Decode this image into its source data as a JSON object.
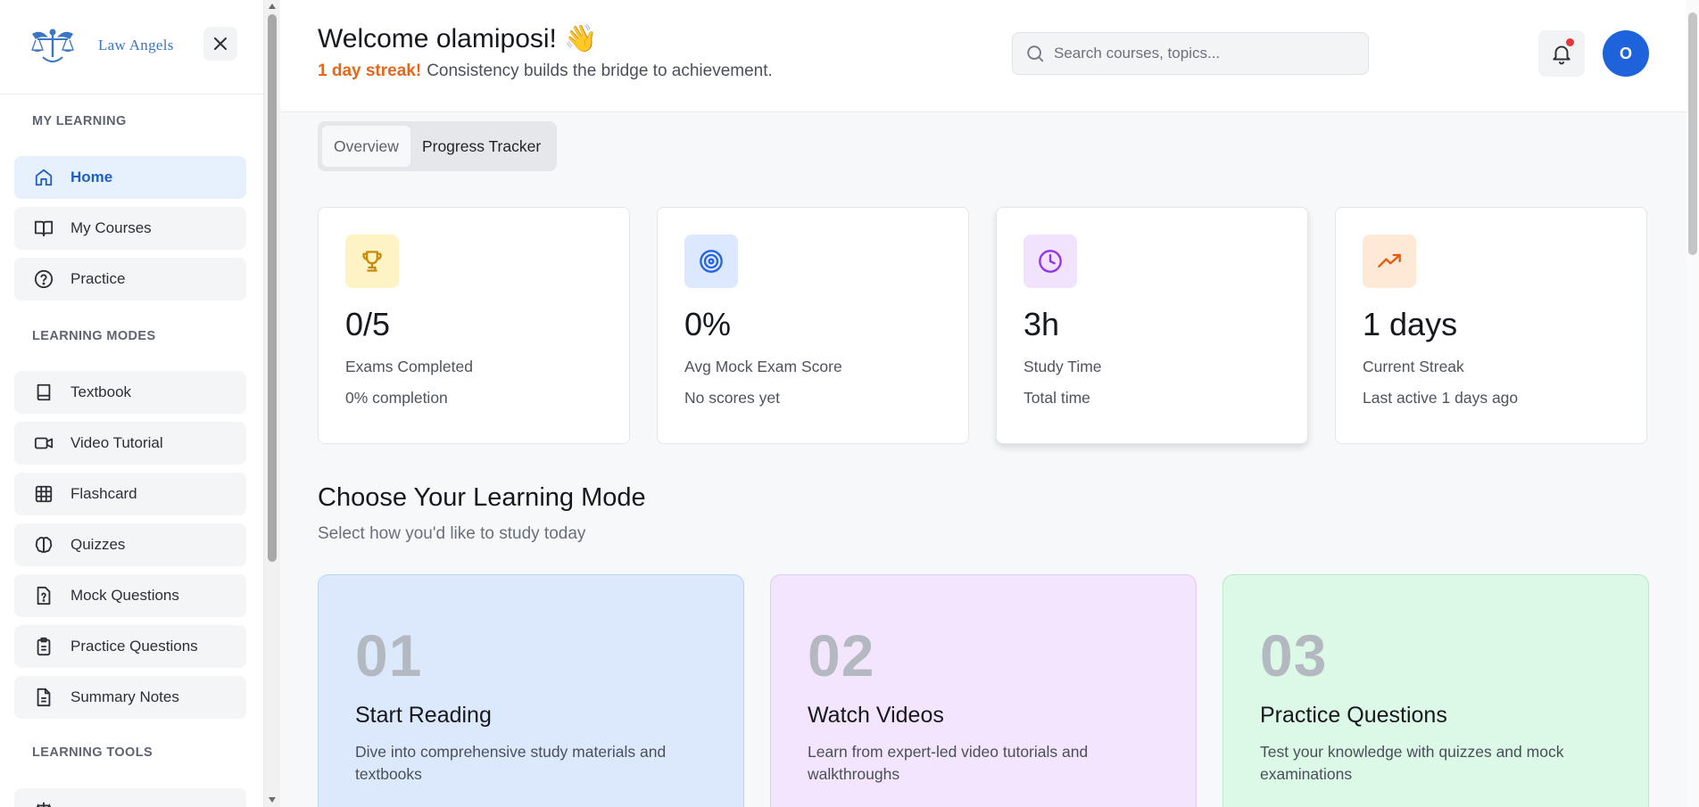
{
  "brand": {
    "name": "Law Angels"
  },
  "sidebar": {
    "sections": {
      "my_learning": "MY LEARNING",
      "learning_modes": "LEARNING MODES",
      "learning_tools": "LEARNING TOOLS"
    },
    "items": [
      {
        "label": "Home",
        "icon": "home-icon",
        "active": true
      },
      {
        "label": "My Courses",
        "icon": "book-open-icon"
      },
      {
        "label": "Practice",
        "icon": "help-circle-icon"
      },
      {
        "label": "Textbook",
        "icon": "book-icon"
      },
      {
        "label": "Video Tutorial",
        "icon": "video-icon"
      },
      {
        "label": "Flashcard",
        "icon": "grid-icon"
      },
      {
        "label": "Quizzes",
        "icon": "brain-icon"
      },
      {
        "label": "Mock Questions",
        "icon": "file-question-icon"
      },
      {
        "label": "Practice Questions",
        "icon": "clipboard-icon"
      },
      {
        "label": "Summary Notes",
        "icon": "file-text-icon"
      }
    ]
  },
  "header": {
    "welcome": "Welcome olamiposi! 👋",
    "streak_highlight": "1 day streak!",
    "streak_message": "Consistency builds the bridge to achievement.",
    "search_placeholder": "Search courses, topics...",
    "avatar_initial": "O"
  },
  "tabs": [
    {
      "label": "Overview",
      "active": true
    },
    {
      "label": "Progress Tracker"
    }
  ],
  "stats": [
    {
      "value": "0/5",
      "label": "Exams Completed",
      "sub": "0% completion",
      "icon": "trophy-icon",
      "icon_bg": "#fdf3c4",
      "icon_color": "#c98a06"
    },
    {
      "value": "0%",
      "label": "Avg Mock Exam Score",
      "sub": "No scores yet",
      "icon": "target-icon",
      "icon_bg": "#dbe8fd",
      "icon_color": "#2563eb"
    },
    {
      "value": "3h",
      "label": "Study Time",
      "sub": "Total time",
      "icon": "clock-icon",
      "icon_bg": "#f1e3fd",
      "icon_color": "#9333ea"
    },
    {
      "value": "1 days",
      "label": "Current Streak",
      "sub": "Last active 1 days ago",
      "icon": "trending-up-icon",
      "icon_bg": "#fde9d6",
      "icon_color": "#ea580c"
    }
  ],
  "learning_mode": {
    "title": "Choose Your Learning Mode",
    "subtitle": "Select how you'd like to study today",
    "cards": [
      {
        "number": "01",
        "title": "Start Reading",
        "description": "Dive into comprehensive study materials and textbooks",
        "bg": "#dce9fc",
        "border": "#b9d3f7"
      },
      {
        "number": "02",
        "title": "Watch Videos",
        "description": "Learn from expert-led video tutorials and walkthroughs",
        "bg": "#f3e5fd",
        "border": "#e2c9f7"
      },
      {
        "number": "03",
        "title": "Practice Questions",
        "description": "Test your knowledge with quizzes and mock examinations",
        "bg": "#dcf8e6",
        "border": "#b6ebc9"
      }
    ]
  }
}
